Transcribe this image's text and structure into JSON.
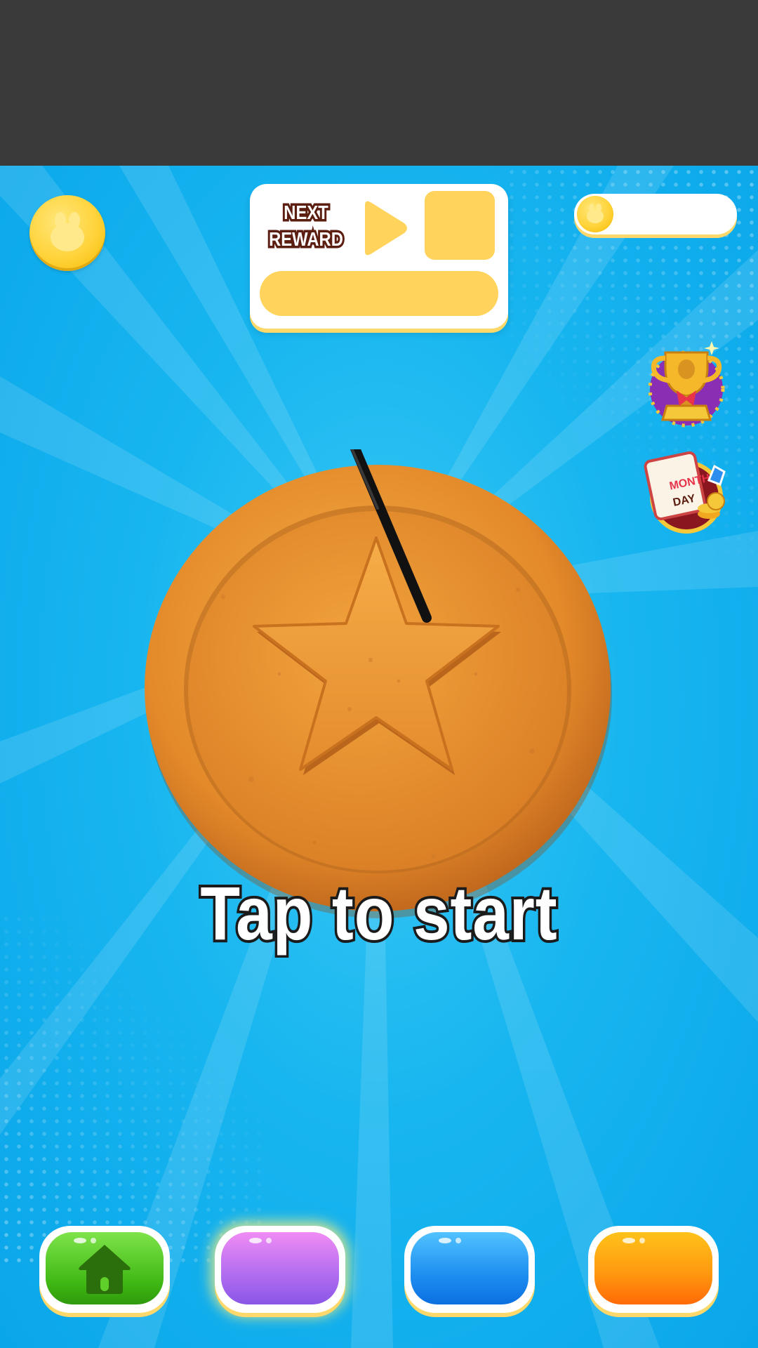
{
  "header": {},
  "currency_left": {
    "icon": "bunny-coin-icon"
  },
  "next_reward": {
    "title": "NEXT\nREWARD",
    "play_icon": "play-icon",
    "progress": 0
  },
  "currency_pill": {
    "icon": "bunny-coin-icon",
    "value": ""
  },
  "side_buttons": [
    {
      "name": "trophy-leaderboard",
      "icon": "trophy-icon"
    },
    {
      "name": "month-day-calendar",
      "icon": "calendar-icon",
      "label_top": "MONTH",
      "label_bottom": "DAY"
    }
  ],
  "game": {
    "cookie_shape": "star",
    "prompt": "Tap to start"
  },
  "nav": [
    {
      "name": "home",
      "icon": "home-icon",
      "color": "#3fb814",
      "active": true
    },
    {
      "name": "purple",
      "icon": "",
      "color": "#b06cf0"
    },
    {
      "name": "blue",
      "icon": "",
      "color": "#1d8ef0"
    },
    {
      "name": "orange",
      "icon": "",
      "color": "#ff9a10"
    }
  ],
  "colors": {
    "sky": "#18b6f0",
    "cookie": "#e08a28",
    "panel_accent": "#ffd35c",
    "text_outline": "#5b1e10"
  }
}
